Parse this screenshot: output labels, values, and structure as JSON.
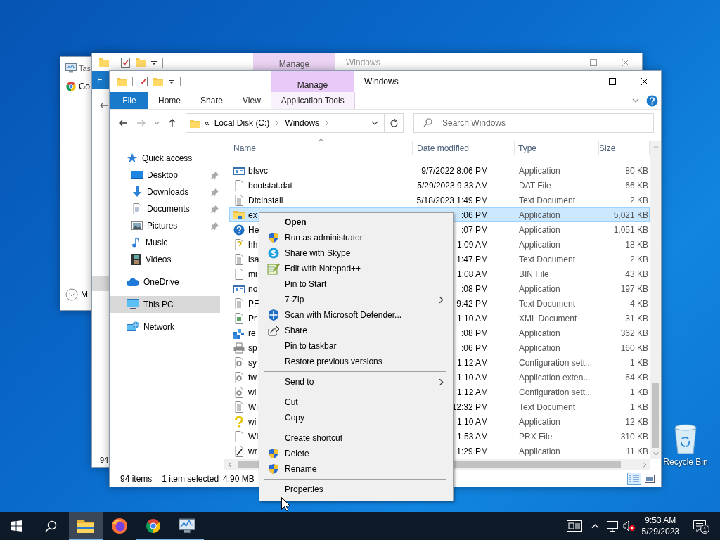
{
  "task_manager": {
    "title": "Tas",
    "items": [
      {
        "label": "Go"
      }
    ],
    "footer": "M"
  },
  "back_explorer": {
    "contextual_tab": "Manage",
    "title": "Windows",
    "file_tab": "F",
    "status": "94"
  },
  "explorer": {
    "contextual_tab": "Manage",
    "title": "Windows",
    "ribbon_tabs": [
      {
        "label": "File",
        "kind": "file"
      },
      {
        "label": "Home",
        "kind": "plain"
      },
      {
        "label": "Share",
        "kind": "plain"
      },
      {
        "label": "View",
        "kind": "plain"
      },
      {
        "label": "Application Tools",
        "kind": "contextual"
      }
    ],
    "address": {
      "overflow": "«",
      "crumbs": [
        "Local Disk (C:)",
        "Windows"
      ]
    },
    "search": {
      "placeholder": "Search Windows"
    },
    "nav": [
      {
        "label": "Quick access",
        "selected": false,
        "children": [
          {
            "label": "Desktop",
            "pinned": true,
            "selected": false
          },
          {
            "label": "Downloads",
            "pinned": true,
            "selected": false
          },
          {
            "label": "Documents",
            "pinned": true,
            "selected": false
          },
          {
            "label": "Pictures",
            "pinned": true,
            "selected": false
          },
          {
            "label": "Music",
            "pinned": false,
            "selected": false
          },
          {
            "label": "Videos",
            "pinned": false,
            "selected": false
          }
        ]
      },
      {
        "label": "OneDrive",
        "selected": false
      },
      {
        "label": "This PC",
        "selected": true
      },
      {
        "label": "Network",
        "selected": false
      }
    ],
    "columns": [
      "Name",
      "Date modified",
      "Type",
      "Size"
    ],
    "rows": [
      {
        "name": "bfsvc",
        "date": "9/7/2022 8:06 PM",
        "type": "Application",
        "size": "80 KB",
        "selected": false
      },
      {
        "name": "bootstat.dat",
        "date": "5/29/2023 9:33 AM",
        "type": "DAT File",
        "size": "66 KB",
        "selected": false
      },
      {
        "name": "DtcInstall",
        "date": "5/18/2023 1:49 PM",
        "type": "Text Document",
        "size": "2 KB",
        "selected": false
      },
      {
        "name": "ex",
        "date": ":06 PM",
        "type": "Application",
        "size": "5,021 KB",
        "selected": true
      },
      {
        "name": "He",
        "date": ":07 PM",
        "type": "Application",
        "size": "1,051 KB",
        "selected": false
      },
      {
        "name": "hh",
        "date": "1:09 AM",
        "type": "Application",
        "size": "18 KB",
        "selected": false
      },
      {
        "name": "lsa",
        "date": "1:47 PM",
        "type": "Text Document",
        "size": "2 KB",
        "selected": false
      },
      {
        "name": "mi",
        "date": "1:08 AM",
        "type": "BIN File",
        "size": "43 KB",
        "selected": false
      },
      {
        "name": "no",
        "date": ":08 PM",
        "type": "Application",
        "size": "197 KB",
        "selected": false
      },
      {
        "name": "PF",
        "date": "9:42 PM",
        "type": "Text Document",
        "size": "4 KB",
        "selected": false
      },
      {
        "name": "Pr",
        "date": "1:10 AM",
        "type": "XML Document",
        "size": "31 KB",
        "selected": false
      },
      {
        "name": "re",
        "date": ":08 PM",
        "type": "Application",
        "size": "362 KB",
        "selected": false
      },
      {
        "name": "sp",
        "date": ":06 PM",
        "type": "Application",
        "size": "160 KB",
        "selected": false
      },
      {
        "name": "sy",
        "date": "1:12 AM",
        "type": "Configuration sett...",
        "size": "1 KB",
        "selected": false
      },
      {
        "name": "tw",
        "date": "1:10 AM",
        "type": "Application exten...",
        "size": "64 KB",
        "selected": false
      },
      {
        "name": "wi",
        "date": "1:12 AM",
        "type": "Configuration sett...",
        "size": "1 KB",
        "selected": false
      },
      {
        "name": "Wi",
        "date": "12:32 PM",
        "type": "Text Document",
        "size": "1 KB",
        "selected": false
      },
      {
        "name": "wi",
        "date": "1:10 AM",
        "type": "Application",
        "size": "12 KB",
        "selected": false
      },
      {
        "name": "WI",
        "date": "1:53 AM",
        "type": "PRX File",
        "size": "310 KB",
        "selected": false
      },
      {
        "name": "wr",
        "date": "1:29 PM",
        "type": "Application",
        "size": "11 KB",
        "selected": false
      }
    ],
    "status": {
      "count": "94 items",
      "selection": "1 item selected",
      "size": "4.90 MB"
    },
    "views": [
      {
        "selected": true
      },
      {
        "selected": false
      }
    ]
  },
  "context_menu": [
    {
      "kind": "item",
      "label": "Open",
      "default": true,
      "submenu": false
    },
    {
      "kind": "item",
      "label": "Run as administrator",
      "default": false,
      "submenu": false
    },
    {
      "kind": "item",
      "label": "Share with Skype",
      "default": false,
      "submenu": false
    },
    {
      "kind": "item",
      "label": "Edit with Notepad++",
      "default": false,
      "submenu": false
    },
    {
      "kind": "item",
      "label": "Pin to Start",
      "default": false,
      "submenu": false
    },
    {
      "kind": "item",
      "label": "7-Zip",
      "default": false,
      "submenu": true
    },
    {
      "kind": "item",
      "label": "Scan with Microsoft Defender...",
      "default": false,
      "submenu": false
    },
    {
      "kind": "item",
      "label": "Share",
      "default": false,
      "submenu": false
    },
    {
      "kind": "item",
      "label": "Pin to taskbar",
      "default": false,
      "submenu": false
    },
    {
      "kind": "item",
      "label": "Restore previous versions",
      "default": false,
      "submenu": false
    },
    {
      "kind": "separator"
    },
    {
      "kind": "item",
      "label": "Send to",
      "default": false,
      "submenu": true
    },
    {
      "kind": "separator"
    },
    {
      "kind": "item",
      "label": "Cut",
      "default": false,
      "submenu": false
    },
    {
      "kind": "item",
      "label": "Copy",
      "default": false,
      "submenu": false
    },
    {
      "kind": "separator"
    },
    {
      "kind": "item",
      "label": "Create shortcut",
      "default": false,
      "submenu": false
    },
    {
      "kind": "item",
      "label": "Delete",
      "default": false,
      "submenu": false
    },
    {
      "kind": "item",
      "label": "Rename",
      "default": false,
      "submenu": false
    },
    {
      "kind": "separator"
    },
    {
      "kind": "item",
      "label": "Properties",
      "default": false,
      "submenu": false
    }
  ],
  "desktop_icons": [
    {
      "label": "Recycle Bin"
    }
  ],
  "taskbar": {
    "apps": [
      {
        "running": true,
        "active": true
      },
      {
        "running": false,
        "active": false
      },
      {
        "running": true,
        "active": false
      },
      {
        "running": true,
        "active": false
      }
    ],
    "clock": {
      "time": "9:53 AM",
      "date": "5/29/2023"
    },
    "notification_count": "1"
  }
}
